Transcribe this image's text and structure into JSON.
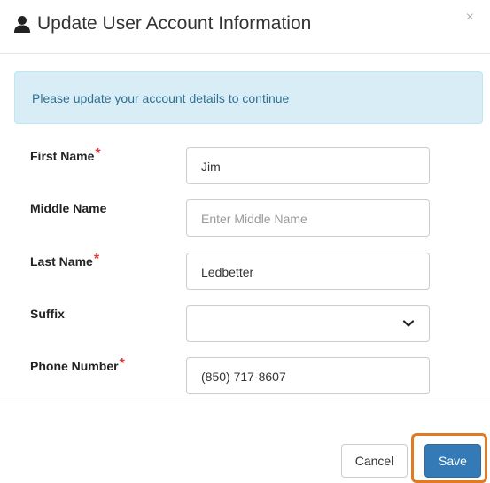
{
  "dialog": {
    "title": "Update User Account Information",
    "close_symbol": "×",
    "title_icon": "user-icon"
  },
  "alert": {
    "message": "Please update your account details to continue"
  },
  "form": {
    "first_name": {
      "label": "First Name",
      "required_mark": "*",
      "value": "Jim",
      "placeholder": ""
    },
    "middle_name": {
      "label": "Middle Name",
      "value": "",
      "placeholder": "Enter Middle Name"
    },
    "last_name": {
      "label": "Last Name",
      "required_mark": "*",
      "value": "Ledbetter",
      "placeholder": ""
    },
    "suffix": {
      "label": "Suffix",
      "value": "",
      "icon": "chevron-down-icon"
    },
    "phone_number": {
      "label": "Phone Number",
      "required_mark": "*",
      "value": "(850) 717-8607",
      "placeholder": ""
    }
  },
  "footer": {
    "cancel_label": "Cancel",
    "save_label": "Save"
  },
  "colors": {
    "primary": "#337ab7",
    "alert_bg": "#d9edf7",
    "alert_text": "#31708f",
    "required": "#e03a3a",
    "highlight": "#e07a23"
  }
}
